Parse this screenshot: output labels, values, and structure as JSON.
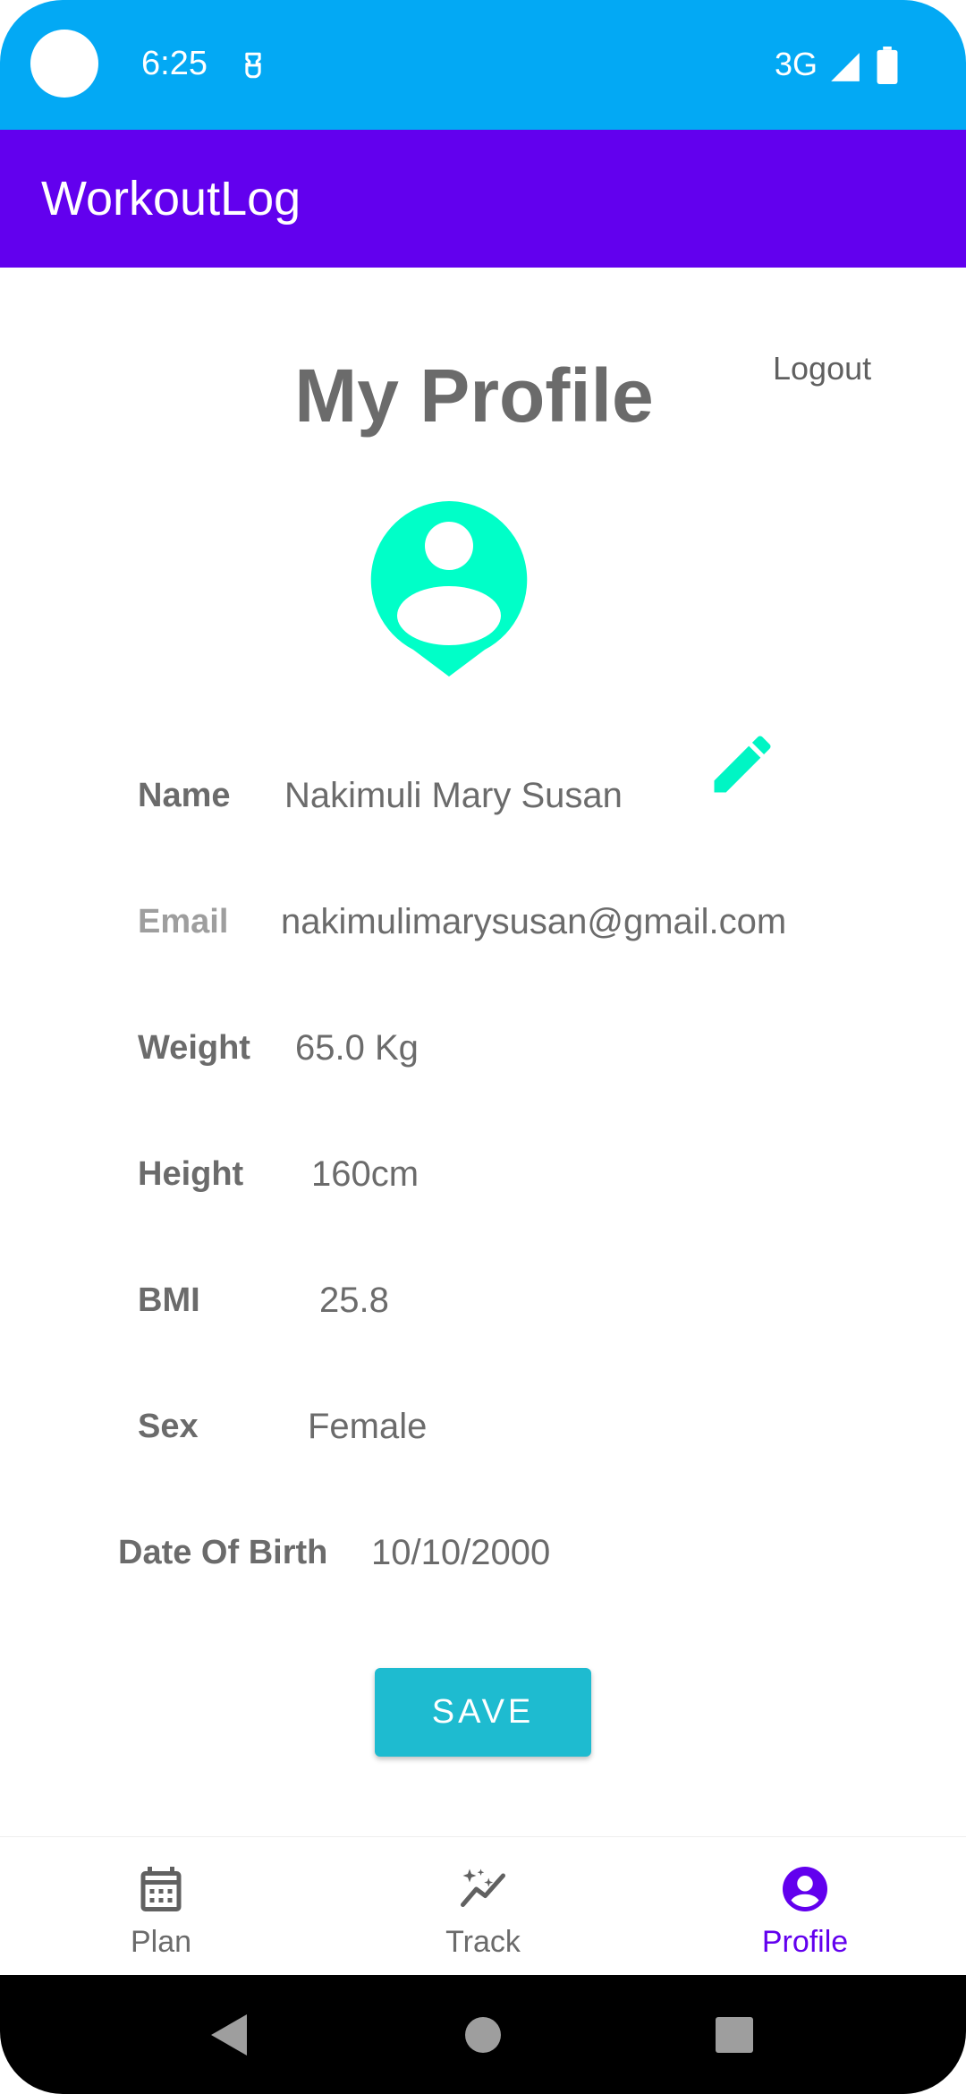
{
  "status_bar": {
    "time": "6:25",
    "network": "3G",
    "notification_icon": "sim-card-icon",
    "signal_icon": "signal-icon",
    "battery_icon": "battery-icon",
    "background_color": "#03a9f4"
  },
  "app_bar": {
    "title": "WorkoutLog",
    "background_color": "#6200ee"
  },
  "profile": {
    "logout_label": "Logout",
    "title": "My Profile",
    "avatar_icon": "account-pin-icon",
    "avatar_color": "#00ffc8",
    "edit_icon": "pencil-icon",
    "fields": {
      "name": {
        "label": "Name",
        "value": "Nakimuli Mary Susan"
      },
      "email": {
        "label": "Email",
        "value": "nakimulimarysusan@gmail.com"
      },
      "weight": {
        "label": "Weight",
        "value": "65.0 Kg"
      },
      "height": {
        "label": "Height",
        "value": "160cm"
      },
      "bmi": {
        "label": "BMI",
        "value": "25.8"
      },
      "sex": {
        "label": "Sex",
        "value": "Female"
      },
      "dob": {
        "label": "Date Of Birth",
        "value": "10/10/2000"
      }
    },
    "save_label": "SAVE",
    "save_color": "#1ebbd0"
  },
  "bottom_nav": {
    "items": [
      {
        "label": "Plan",
        "icon": "calendar-icon",
        "active": false
      },
      {
        "label": "Track",
        "icon": "auto-graph-icon",
        "active": false
      },
      {
        "label": "Profile",
        "icon": "account-circle-icon",
        "active": true
      }
    ],
    "active_color": "#6200ee"
  },
  "system_nav": {
    "back_icon": "back-triangle-icon",
    "home_icon": "home-circle-icon",
    "recents_icon": "recents-square-icon"
  }
}
